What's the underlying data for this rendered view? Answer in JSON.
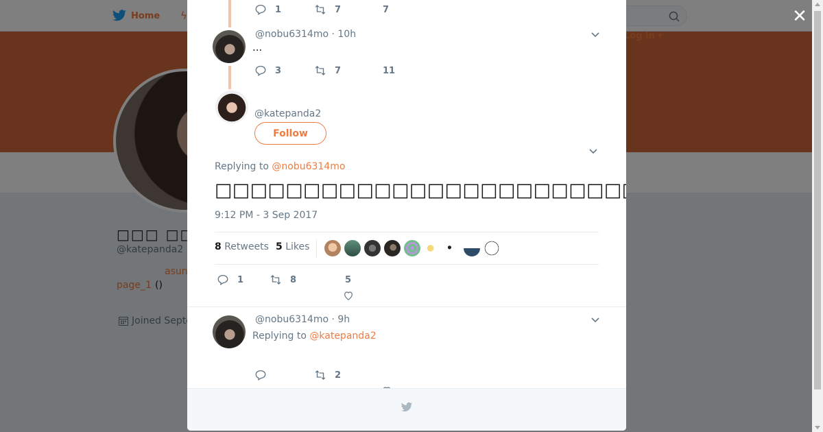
{
  "nav": {
    "home_label": "Home",
    "login_label": "Log in"
  },
  "profile": {
    "display_name": "□□□ □□□□",
    "handle": "@katepanda2",
    "bio_link_1": "asun",
    "bio_link_2": "page_1",
    "bio_paren": "()",
    "joined": "Joined Septe"
  },
  "thread": {
    "prev_tweet_actions": {
      "replies": "1",
      "retweets": "7",
      "likes": "7"
    },
    "reply_tweet": {
      "handle": "@nobu6314mo",
      "time": "10h",
      "text": "...",
      "replies": "3",
      "retweets": "7",
      "likes": "11"
    },
    "main_tweet": {
      "handle": "@katepanda2",
      "follow_label": "Follow",
      "replying_prefix": "Replying to",
      "replying_to": "@nobu6314mo",
      "text": "□□□□□□□□□□□□□□□□□□□□□□□□□□□□□□□□□□□□□□□□□",
      "timestamp": "9:12 PM - 3 Sep 2017",
      "retweet_count": "8",
      "retweet_label": "Retweets",
      "like_count": "5",
      "like_label": "Likes",
      "replies": "1",
      "retweets": "8",
      "likes": "5"
    },
    "next_tweet": {
      "handle": "@nobu6314mo",
      "time": "9h",
      "replying_prefix": "Replying to",
      "replying_to": "@katepanda2",
      "retweets": "2"
    }
  },
  "colors": {
    "accent": "#f07b3f",
    "banner": "#d3693a",
    "thread_line": "#f5c2ae"
  }
}
